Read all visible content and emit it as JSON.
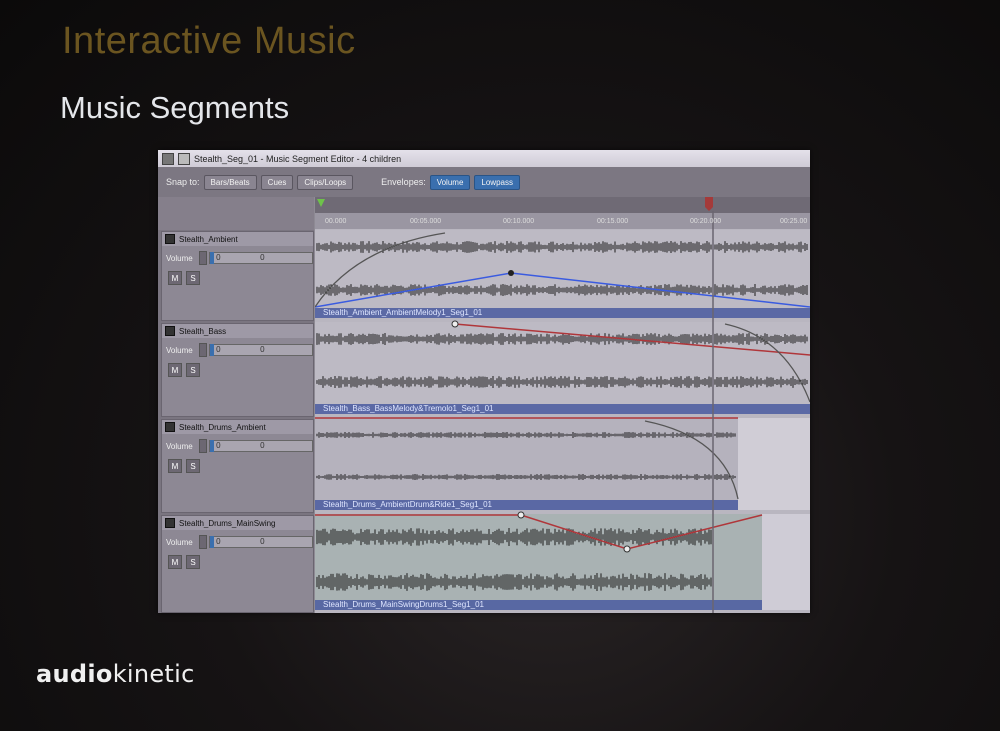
{
  "slide": {
    "title": "Interactive Music",
    "subtitle": "Music Segments",
    "logo_bold": "audio",
    "logo_light": "kinetic"
  },
  "window": {
    "title": "Stealth_Seg_01 - Music Segment Editor - 4 children"
  },
  "toolbar": {
    "snap_label": "Snap to:",
    "snap_buttons": [
      "Bars/Beats",
      "Cues",
      "Clips/Loops"
    ],
    "envelopes_label": "Envelopes:",
    "envelope_buttons": [
      "Volume",
      "Lowpass"
    ],
    "active_envelope": "Volume"
  },
  "timeline": {
    "labels": [
      "00.000",
      "00:05.000",
      "00:10.000",
      "00:15.000",
      "00:20.000",
      "00:25.00"
    ]
  },
  "tracks": [
    {
      "name": "Stealth_Ambient",
      "volume_label": "Volume",
      "volume_value": "0",
      "volume_value2": "0",
      "mute": "M",
      "solo": "S",
      "clip": "Stealth_Ambient_AmbientMelody1_Seg1_01"
    },
    {
      "name": "Stealth_Bass",
      "volume_label": "Volume",
      "volume_value": "0",
      "volume_value2": "0",
      "mute": "M",
      "solo": "S",
      "clip": "Stealth_Bass_BassMelody&Tremolo1_Seg1_01"
    },
    {
      "name": "Stealth_Drums_Ambient",
      "volume_label": "Volume",
      "volume_value": "0",
      "volume_value2": "0",
      "mute": "M",
      "solo": "S",
      "clip": "Stealth_Drums_AmbientDrum&Ride1_Seg1_01"
    },
    {
      "name": "Stealth_Drums_MainSwing",
      "volume_label": "Volume",
      "volume_value": "0",
      "volume_value2": "0",
      "mute": "M",
      "solo": "S",
      "clip": "Stealth_Drums_MainSwingDrums1_Seg1_01"
    }
  ],
  "colors": {
    "volume_envelope": "#3a5be0",
    "lowpass_envelope": "#b0363a",
    "waveform": "#1a1a1a",
    "playhead": "#6a6570"
  }
}
